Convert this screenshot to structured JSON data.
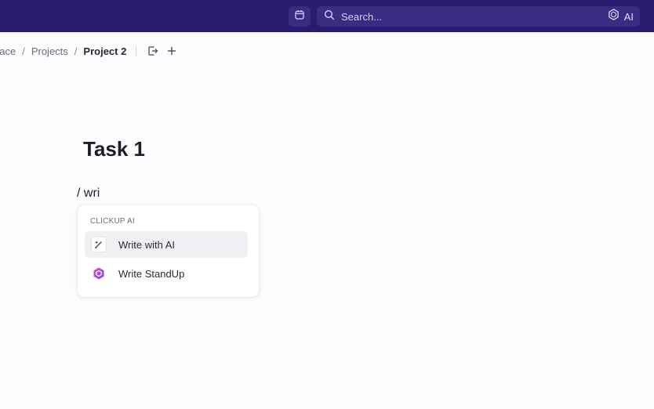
{
  "topbar": {
    "search_placeholder": "Search...",
    "ai_label": "AI"
  },
  "breadcrumbs": {
    "items": [
      "pace",
      "Projects",
      "Project 2"
    ],
    "separator": "/"
  },
  "task": {
    "title": "Task 1",
    "slash_input": "/ wri"
  },
  "command_menu": {
    "header": "CLICKUP AI",
    "items": [
      {
        "label": "Write with AI",
        "icon": "pen-sparkle-icon"
      },
      {
        "label": "Write StandUp",
        "icon": "clickup-ai-icon"
      }
    ]
  },
  "colors": {
    "topbar": "#2b1b6e",
    "topbar_control": "#3b2b82",
    "page_background": "#fcfcfe",
    "ai_pink": "#d94ec4",
    "ai_purple": "#7b4be0"
  }
}
